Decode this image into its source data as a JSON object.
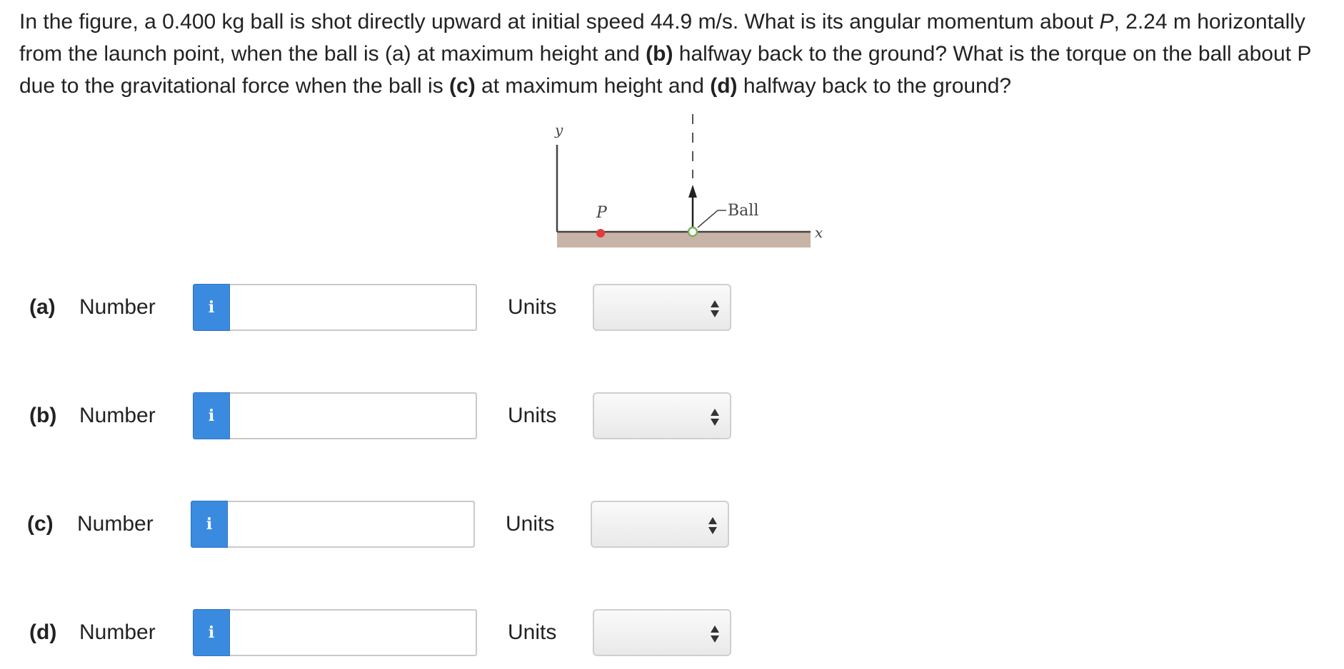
{
  "question": {
    "seg1": "In the figure, a 0.400 kg ball is shot directly upward at initial speed 44.9 m/s. What is its angular momentum about ",
    "p_italic": "P",
    "seg2": ", 2.24 m horizontally from the launch point, when the ball is (a) at maximum height and ",
    "b_label": "(b)",
    "seg3": " halfway back to the ground? What is the torque on the ball about P due to the gravitational force when the ball is ",
    "c_label": "(c)",
    "seg4": " at maximum height and ",
    "d_label": "(d)",
    "seg5": " halfway back to the ground?"
  },
  "figure": {
    "y_label": "y",
    "x_label": "x",
    "p_label": "P",
    "ball_label": "Ball",
    "colors": {
      "ground": "#c8b4a6",
      "point_p": "#e23a3a",
      "ball": "#7ab05a",
      "axis": "#444444"
    }
  },
  "parts": [
    {
      "label": "(a)",
      "number_label": "Number",
      "info_icon": "i",
      "value": "",
      "units_label": "Units",
      "units_value": ""
    },
    {
      "label": "(b)",
      "number_label": "Number",
      "info_icon": "i",
      "value": "",
      "units_label": "Units",
      "units_value": ""
    },
    {
      "label": "(c)",
      "number_label": "Number",
      "info_icon": "i",
      "value": "",
      "units_label": "Units",
      "units_value": ""
    },
    {
      "label": "(d)",
      "number_label": "Number",
      "info_icon": "i",
      "value": "",
      "units_label": "Units",
      "units_value": ""
    }
  ],
  "colors": {
    "info_button": "#3a8be0"
  }
}
